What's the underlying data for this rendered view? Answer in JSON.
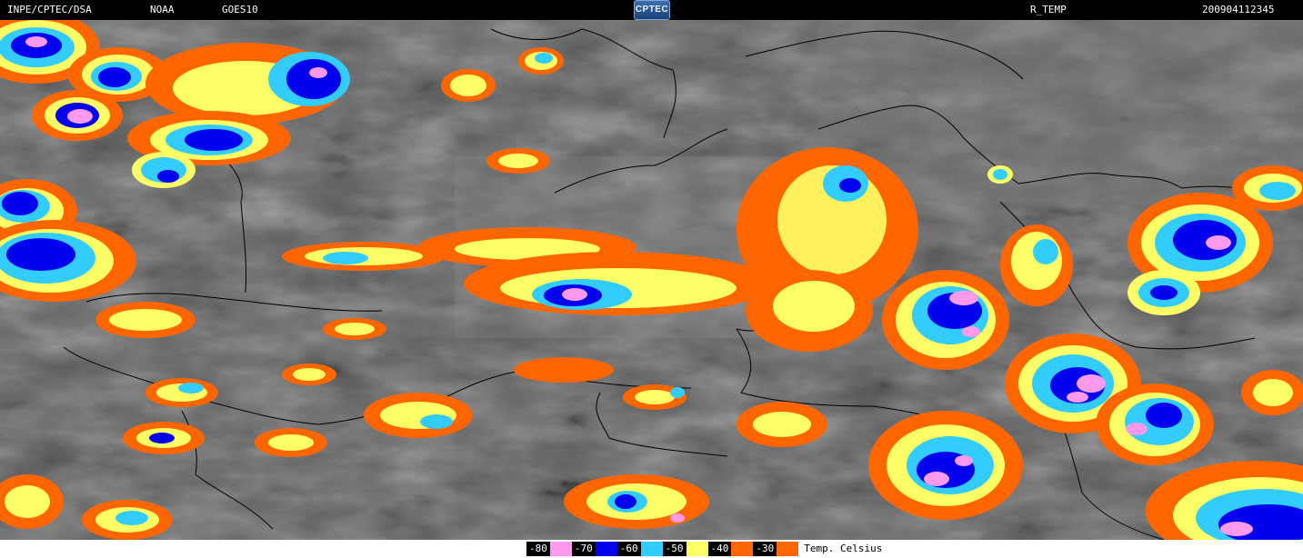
{
  "header": {
    "agency": "INPE/CPTEC/DSA",
    "noaa": "NOAA",
    "satellite": "GOES10",
    "logo_text": "CPTEC",
    "product": "R_TEMP",
    "timestamp": "200904112345"
  },
  "legend": {
    "items": [
      {
        "label": "-80",
        "color": "#ff99ee"
      },
      {
        "label": "-70",
        "color": "#0000ee"
      },
      {
        "label": "-60",
        "color": "#33ccff"
      },
      {
        "label": "-50",
        "color": "#ffff66"
      },
      {
        "label": "-40",
        "color": "#ff6600"
      },
      {
        "label": "-30",
        "color": "#ff6600"
      }
    ],
    "unit": "Temp. Celsius"
  },
  "colors": {
    "background": "#000000",
    "cloud_base": "#5a5a5a",
    "border_lines": "#000000"
  }
}
